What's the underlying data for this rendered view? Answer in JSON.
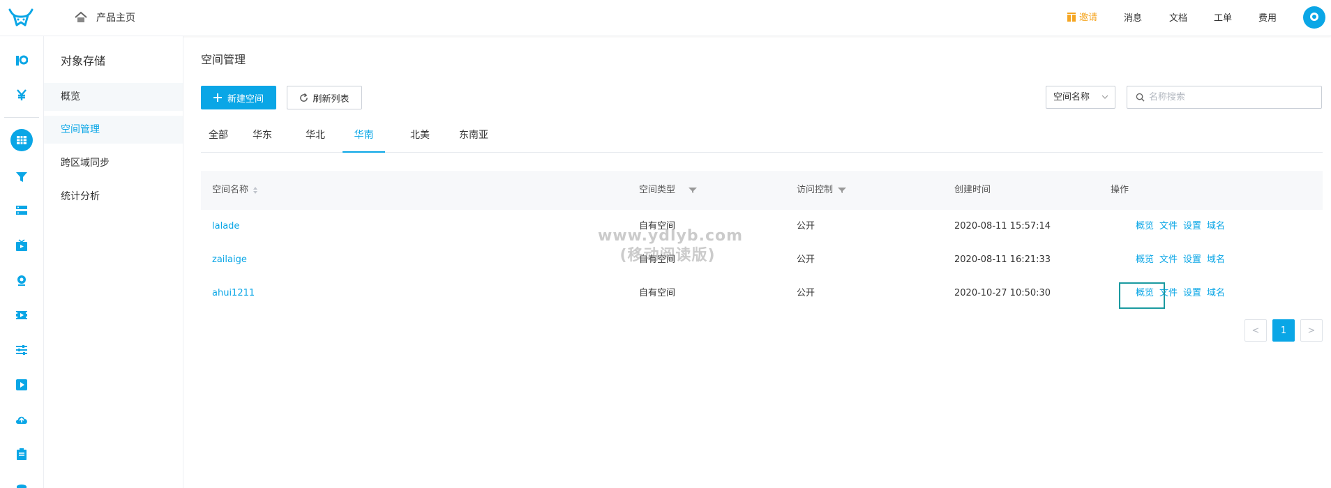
{
  "header": {
    "home_label": "产品主页",
    "invite_label": "邀请",
    "links": {
      "messages": "消息",
      "docs": "文档",
      "tickets": "工单",
      "billing": "费用"
    }
  },
  "sidebar": {
    "title": "对象存储",
    "items": [
      {
        "label": "概览"
      },
      {
        "label": "空间管理"
      },
      {
        "label": "跨区域同步"
      },
      {
        "label": "统计分析"
      }
    ]
  },
  "main": {
    "title": "空间管理",
    "new_button": "新建空间",
    "refresh_button": "刷新列表",
    "filter_select": "空间名称",
    "search_placeholder": "名称搜索",
    "tabs": [
      {
        "label": "全部"
      },
      {
        "label": "华东"
      },
      {
        "label": "华北"
      },
      {
        "label": "华南",
        "active": true
      },
      {
        "label": "北美"
      },
      {
        "label": "东南亚"
      }
    ],
    "table": {
      "columns": [
        "空间名称",
        "空间类型",
        "访问控制",
        "创建时间",
        "操作"
      ],
      "rows": [
        {
          "name": "lalade",
          "type": "自有空间",
          "access": "公开",
          "created": "2020-08-11 15:57:14"
        },
        {
          "name": "zailaige",
          "type": "自有空间",
          "access": "公开",
          "created": "2020-08-11 16:21:33"
        },
        {
          "name": "ahui1211",
          "type": "自有空间",
          "access": "公开",
          "created": "2020-10-27 10:50:30"
        }
      ],
      "actions": [
        "概览",
        "文件",
        "设置",
        "域名"
      ]
    },
    "pagination": {
      "current": "1",
      "prev": "<",
      "next": ">"
    }
  },
  "watermark": {
    "line1": "www.ydlyb.com",
    "line2": "(移动阅读版)"
  },
  "colors": {
    "accent": "#0aa6e6",
    "invite": "#f5a623",
    "highlight_box": "#1b9aa0"
  }
}
